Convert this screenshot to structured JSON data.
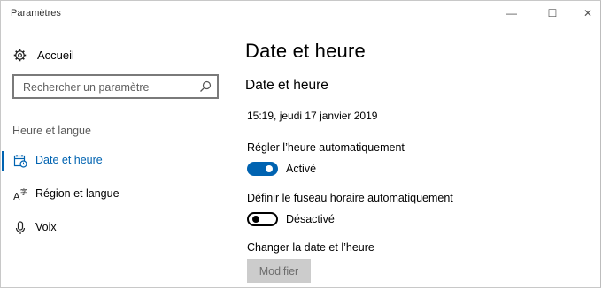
{
  "window": {
    "title": "Paramètres",
    "controls": {
      "minimize": "—",
      "maximize": "☐",
      "close": "✕"
    }
  },
  "sidebar": {
    "home": {
      "label": "Accueil",
      "icon": "gear-icon"
    },
    "search": {
      "placeholder": "Rechercher un paramètre",
      "icon": "search-icon"
    },
    "section_label": "Heure et langue",
    "items": [
      {
        "label": "Date et heure",
        "icon": "calendar-clock-icon",
        "active": true
      },
      {
        "label": "Région et langue",
        "icon": "language-icon",
        "active": false
      },
      {
        "label": "Voix",
        "icon": "microphone-icon",
        "active": false
      }
    ]
  },
  "main": {
    "page_title": "Date et heure",
    "section_title": "Date et heure",
    "current_datetime": "15:19, jeudi 17 janvier 2019",
    "auto_time": {
      "label": "Régler l’heure automatiquement",
      "state_text": "Activé",
      "on": true
    },
    "auto_timezone": {
      "label": "Définir le fuseau horaire automatiquement",
      "state_text": "Désactivé",
      "on": false
    },
    "change": {
      "label": "Changer la date et l’heure",
      "button": "Modifier",
      "button_enabled": false
    }
  },
  "colors": {
    "accent": "#0063b1",
    "disabled_button_bg": "#cccccc",
    "disabled_button_text": "#6d6d6d"
  }
}
